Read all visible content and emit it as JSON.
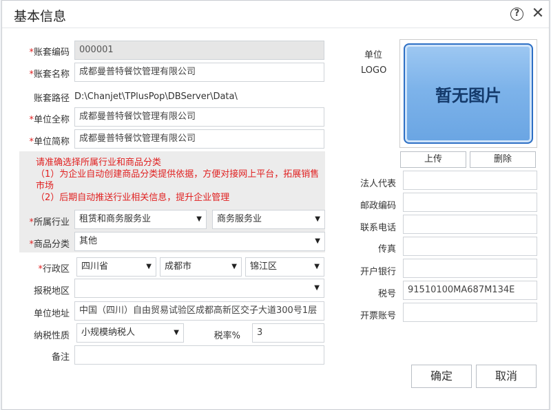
{
  "dialog": {
    "title": "基本信息",
    "help_icon": "question-circle-icon",
    "close_icon": "close-x-icon"
  },
  "form": {
    "account_code": {
      "label": "账套编码",
      "value": "000001"
    },
    "account_name": {
      "label": "账套名称",
      "value": "成都曼普特餐饮管理有限公司"
    },
    "account_path": {
      "label": "账套路径",
      "value": "D:\\Chanjet\\TPlusPop\\DBServer\\Data\\"
    },
    "company_full_name": {
      "label": "单位全称",
      "value": "成都曼普特餐饮管理有限公司"
    },
    "company_short_name": {
      "label": "单位简称",
      "value": "成都曼普特餐饮管理有限公司"
    },
    "hint": {
      "line1": "请准确选择所属行业和商品分类",
      "line2": "（1）为企业自动创建商品分类提供依据，方便对接网上平台，拓展销售市场",
      "line3": "（2）后期自动推送行业相关信息，提升企业管理"
    },
    "industry": {
      "label": "所属行业",
      "value1": "租赁和商务服务业",
      "value2": "商务服务业"
    },
    "product_category": {
      "label": "商品分类",
      "value": "其他"
    },
    "region": {
      "label": "行政区",
      "province": "四川省",
      "city": "成都市",
      "district": "锦江区"
    },
    "tax_region": {
      "label": "报税地区",
      "value": ""
    },
    "address": {
      "label": "单位地址",
      "value": "中国（四川）自由贸易试验区成都高新区交子大道300号1层"
    },
    "taxpayer_type": {
      "label": "纳税性质",
      "value": "小规模纳税人"
    },
    "tax_rate": {
      "label": "税率%",
      "value": "3"
    },
    "remark": {
      "label": "备注",
      "value": ""
    }
  },
  "logo": {
    "label_line1": "单位",
    "label_line2": "LOGO",
    "placeholder": "暂无图片",
    "upload_label": "上传",
    "delete_label": "删除"
  },
  "right_fields": {
    "legal_rep": {
      "label": "法人代表",
      "value": ""
    },
    "postal_code": {
      "label": "邮政编码",
      "value": ""
    },
    "phone": {
      "label": "联系电话",
      "value": ""
    },
    "fax": {
      "label": "传真",
      "value": ""
    },
    "bank": {
      "label": "开户银行",
      "value": ""
    },
    "tax_no": {
      "label": "税号",
      "value": "91510100MA687M134E"
    },
    "invoice_account": {
      "label": "开票账号",
      "value": ""
    }
  },
  "actions": {
    "ok_label": "确定",
    "cancel_label": "取消"
  },
  "required_mark": "*",
  "dropdown_arrow": "▼",
  "colors": {
    "required": "#e02020",
    "hint_bg": "#ececec",
    "logo_blue": "#6aa5e3"
  }
}
